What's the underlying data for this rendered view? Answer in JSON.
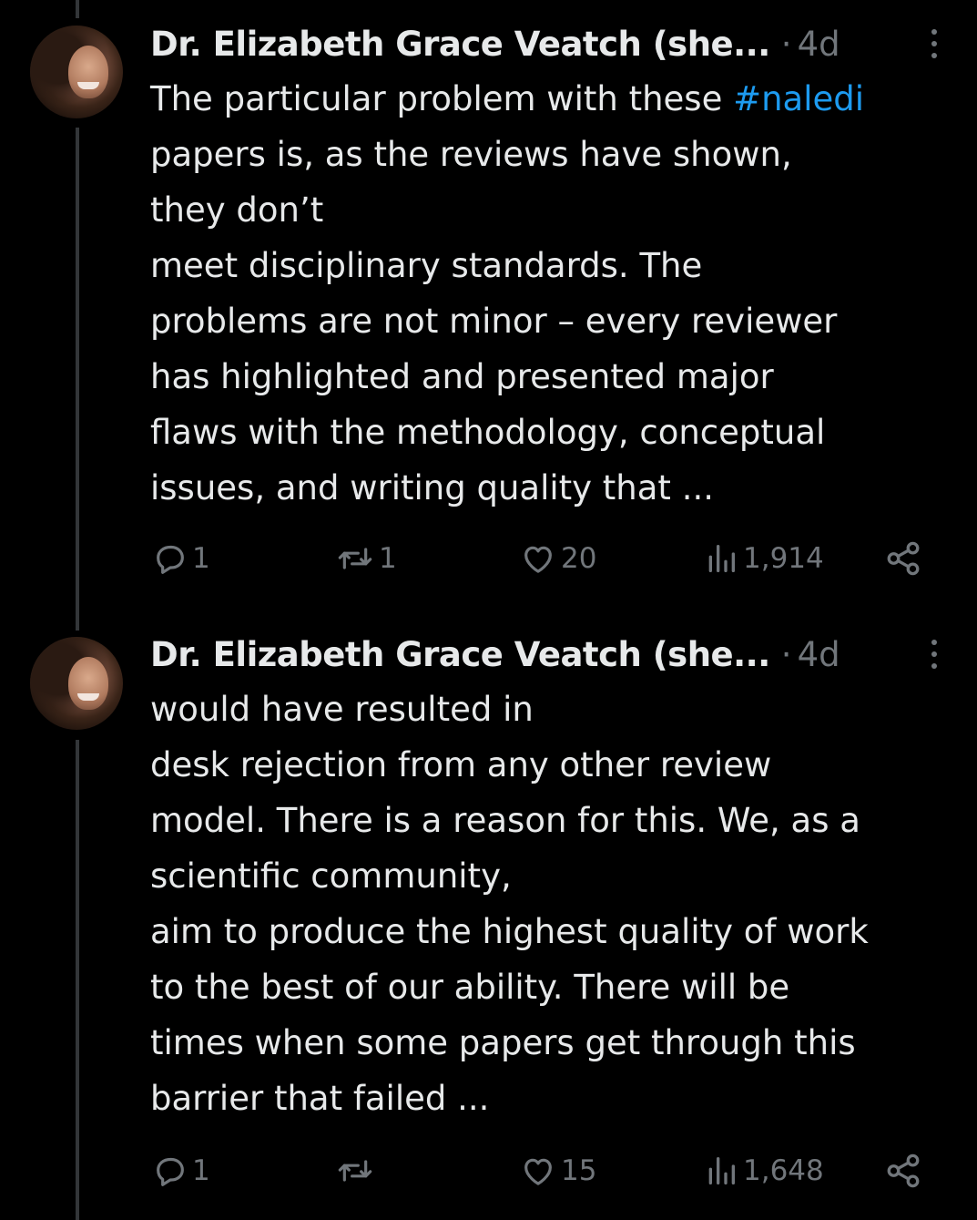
{
  "colors": {
    "background": "#000000",
    "text": "#e7e9ea",
    "muted": "#71767b",
    "link": "#1d9bf0",
    "thread_line": "#333639"
  },
  "tweets": [
    {
      "author": "Dr. Elizabeth Grace Veatch (she...",
      "separator": "·",
      "age": "4d",
      "lines": [
        {
          "before": "The particular problem with these ",
          "hashtag": "#naledi"
        },
        {
          "text": "papers is, as the reviews have shown,"
        },
        {
          "text": "they don’t"
        },
        {
          "text": "meet disciplinary standards. The"
        },
        {
          "text": "problems are not minor – every reviewer"
        },
        {
          "text": "has highlighted and presented major"
        },
        {
          "text": "flaws with the methodology, conceptual"
        },
        {
          "text": "issues, and writing quality that ..."
        }
      ],
      "replies": "1",
      "reposts": "1",
      "likes": "20",
      "views": "1,914"
    },
    {
      "author": "Dr. Elizabeth Grace Veatch (she...",
      "separator": "·",
      "age": "4d",
      "lines": [
        {
          "text": "would have resulted in"
        },
        {
          "text": "desk rejection from any other review"
        },
        {
          "text": "model. There is a reason for this. We, as a"
        },
        {
          "text": "scientific community,"
        },
        {
          "text": "aim to produce the highest quality of work"
        },
        {
          "text": "to the best of our ability. There will be"
        },
        {
          "text": "times when some papers get through this"
        },
        {
          "text": "barrier that failed ..."
        }
      ],
      "replies": "1",
      "reposts": "",
      "likes": "15",
      "views": "1,648"
    }
  ],
  "icons": {
    "more": "more-vertical-icon",
    "reply": "reply-icon",
    "repost": "repost-icon",
    "like": "heart-icon",
    "views": "views-icon",
    "share": "share-icon"
  }
}
